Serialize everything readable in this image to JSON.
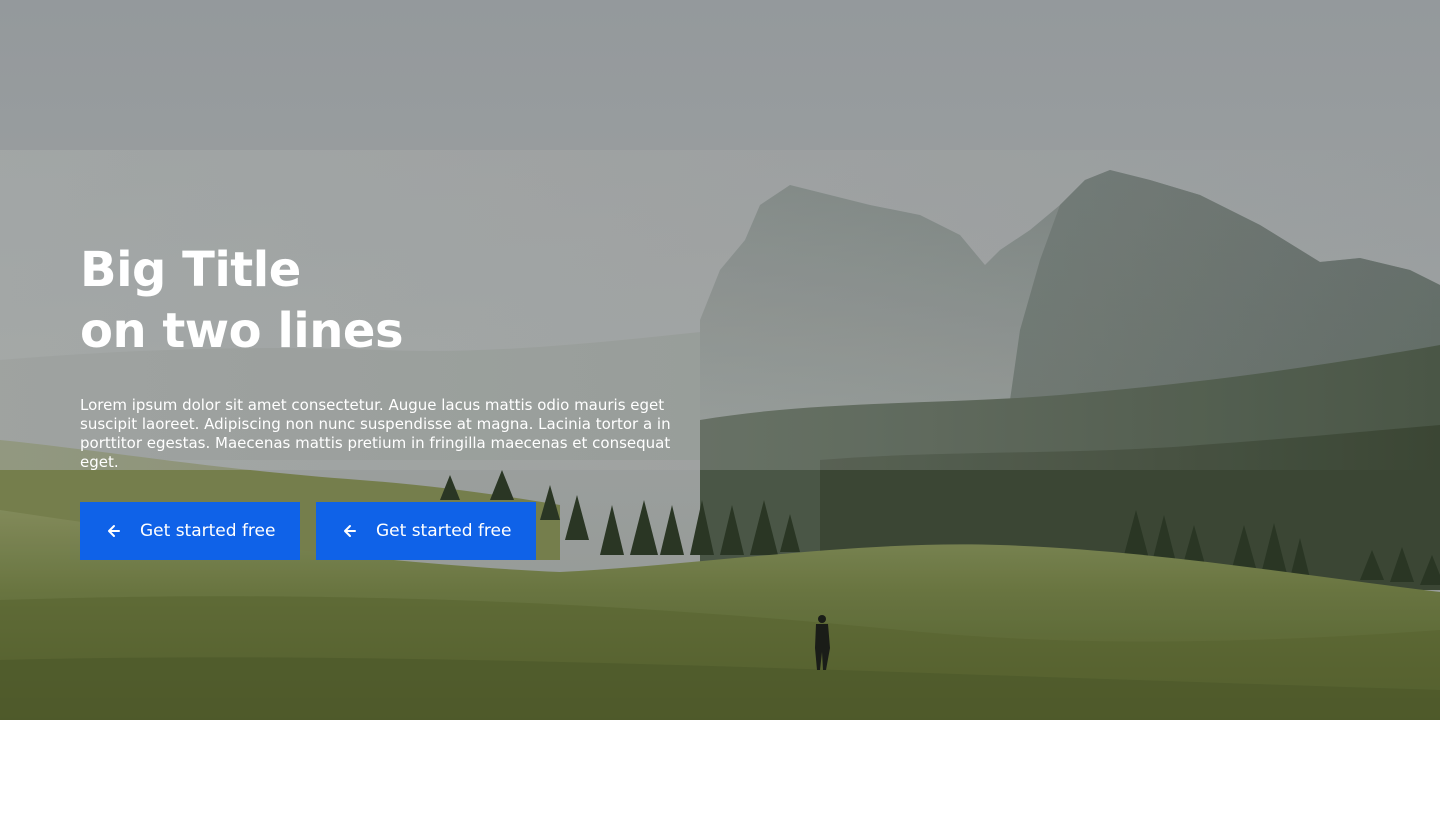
{
  "hero": {
    "title_line_1": "Big Title",
    "title_line_2": "on two lines",
    "body": "Lorem ipsum dolor sit amet consectetur. Augue lacus mattis odio mauris eget suscipit laoreet. Adipiscing non nunc suspendisse at magna. Lacinia tortor a in porttitor egestas. Maecenas mattis pretium in fringilla maecenas et consequat eget.",
    "buttons": [
      {
        "label": "Get started free",
        "icon": "arrow-left-icon"
      },
      {
        "label": "Get started free",
        "icon": "arrow-left-icon"
      }
    ],
    "background_image": "misty mountains and green meadow with a walking person"
  },
  "colors": {
    "button_bg": "#0f62e8",
    "text": "#ffffff",
    "page_bg": "#ffffff"
  }
}
